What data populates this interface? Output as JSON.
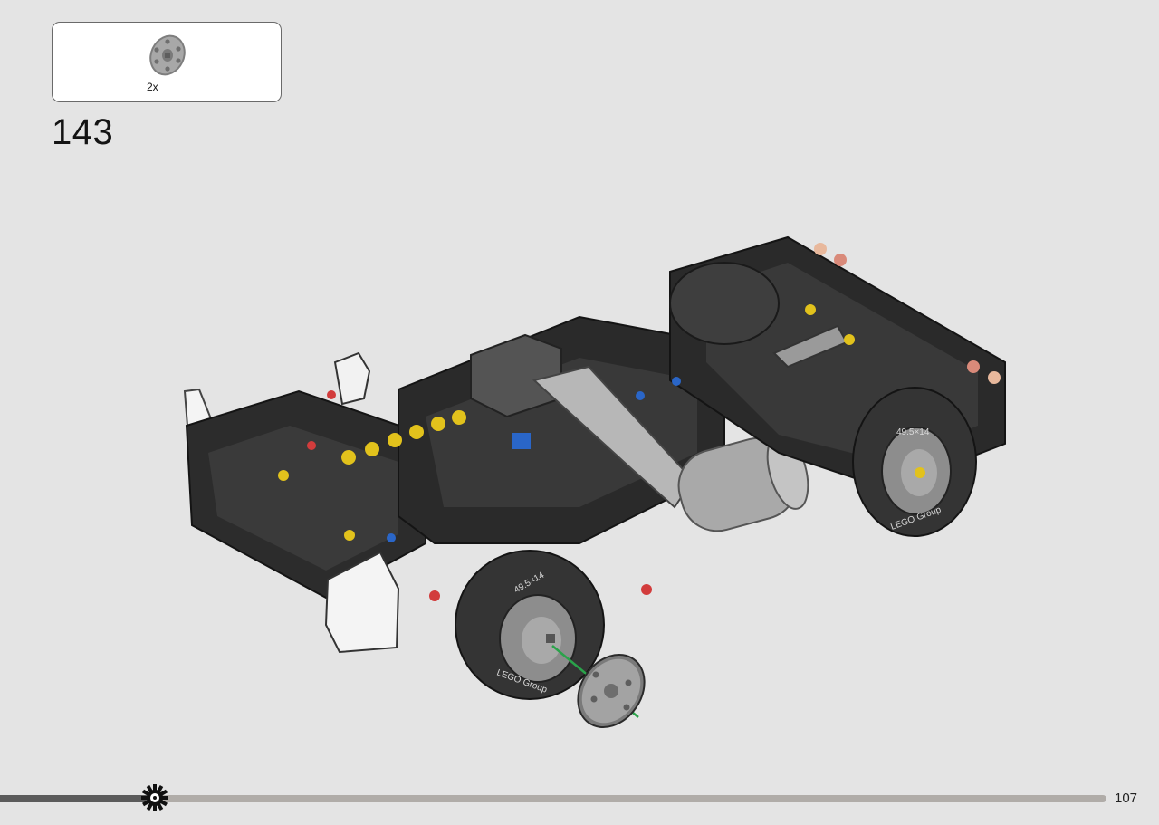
{
  "parts_callout": {
    "part_icon": "grey-wheel-hub-icon",
    "quantity": "2x"
  },
  "step": {
    "number": "143"
  },
  "model": {
    "tire_text_1": "49.5×14",
    "tire_text_2": "49.5×14",
    "tire_text_3": "LEGO Group",
    "tire_text_4": "LEGO Group"
  },
  "progress": {
    "fraction": 0.14,
    "gear_icon": "gear-icon"
  },
  "footer": {
    "page_number": "107"
  },
  "colors": {
    "background": "#e4e4e4",
    "frame_black": "#2a2a2a",
    "tire_dark": "#333333",
    "hub_grey": "#8d8d8d",
    "progress_done": "#5b5b5b",
    "progress_rest": "#b0aca8",
    "arrow_green": "#2aa34a"
  }
}
